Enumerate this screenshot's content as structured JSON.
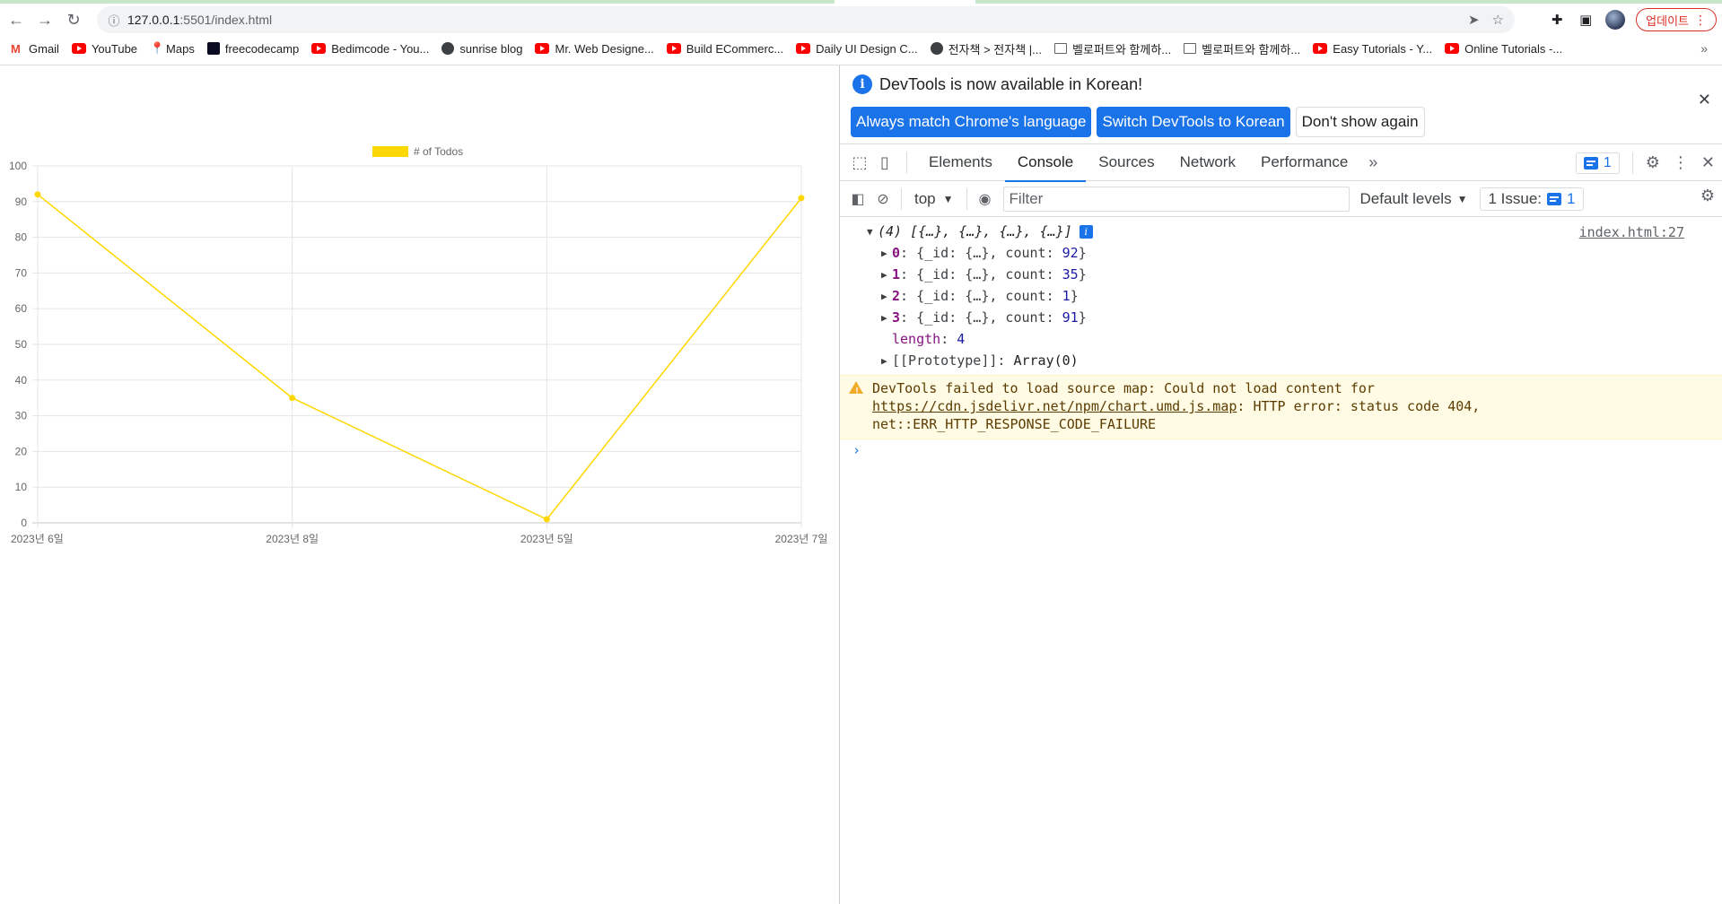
{
  "browser": {
    "url_host": "127.0.0.1",
    "url_path": ":5501/index.html",
    "update_label": "업데이트",
    "bookmarks": [
      {
        "label": "Gmail",
        "icon": "gmail-icon"
      },
      {
        "label": "YouTube",
        "icon": "youtube-icon"
      },
      {
        "label": "Maps",
        "icon": "maps-icon"
      },
      {
        "label": "freecodecamp",
        "icon": "freecodecamp-icon"
      },
      {
        "label": "Bedimcode - You...",
        "icon": "youtube-icon"
      },
      {
        "label": "sunrise blog",
        "icon": "globe-icon"
      },
      {
        "label": "Mr. Web Designe...",
        "icon": "youtube-icon"
      },
      {
        "label": "Build ECommerc...",
        "icon": "youtube-icon"
      },
      {
        "label": "Daily UI Design C...",
        "icon": "youtube-icon"
      },
      {
        "label": "전자책 > 전자책 |...",
        "icon": "globe-icon"
      },
      {
        "label": "벨로퍼트와 함께하...",
        "icon": "book-icon"
      },
      {
        "label": "벨로퍼트와 함께하...",
        "icon": "book-icon"
      },
      {
        "label": "Easy Tutorials - Y...",
        "icon": "youtube-icon"
      },
      {
        "label": "Online Tutorials -...",
        "icon": "youtube-icon"
      }
    ]
  },
  "chart_data": {
    "type": "line",
    "categories": [
      "2023년 6일",
      "2023년 8일",
      "2023년 5일",
      "2023년 7일"
    ],
    "series": [
      {
        "name": "# of Todos",
        "values": [
          92,
          35,
          1,
          91
        ],
        "color": "#ffd700"
      }
    ],
    "ylim": [
      0,
      100
    ],
    "yticks": [
      0,
      10,
      20,
      30,
      40,
      50,
      60,
      70,
      80,
      90,
      100
    ],
    "grid": true,
    "legend": "top-center"
  },
  "devtools": {
    "infobar": {
      "message": "DevTools is now available in Korean!",
      "btn_match": "Always match Chrome's language",
      "btn_switch": "Switch DevTools to Korean",
      "btn_dismiss": "Don't show again"
    },
    "tabs": [
      "Elements",
      "Console",
      "Sources",
      "Network",
      "Performance"
    ],
    "active_tab": "Console",
    "issues_badge": "1",
    "context": "top",
    "filter_placeholder": "Filter",
    "levels": "Default levels",
    "issues_label": "1 Issue:",
    "issues_count": "1",
    "log": {
      "summary": "(4) [{…}, {…}, {…}, {…}]",
      "source": "index.html:27",
      "items": [
        {
          "index": "0",
          "count": "92"
        },
        {
          "index": "1",
          "count": "35"
        },
        {
          "index": "2",
          "count": "1"
        },
        {
          "index": "3",
          "count": "91"
        }
      ],
      "length_key": "length",
      "length_value": "4",
      "prototype": "[[Prototype]]",
      "prototype_value": "Array(0)"
    },
    "warning": {
      "text_before": "DevTools failed to load source map: Could not load content for ",
      "link": "https://cdn.jsdelivr.net/npm/chart.umd.js.map",
      "text_after": ": HTTP error: status code 404, net::ERR_HTTP_RESPONSE_CODE_FAILURE"
    }
  }
}
